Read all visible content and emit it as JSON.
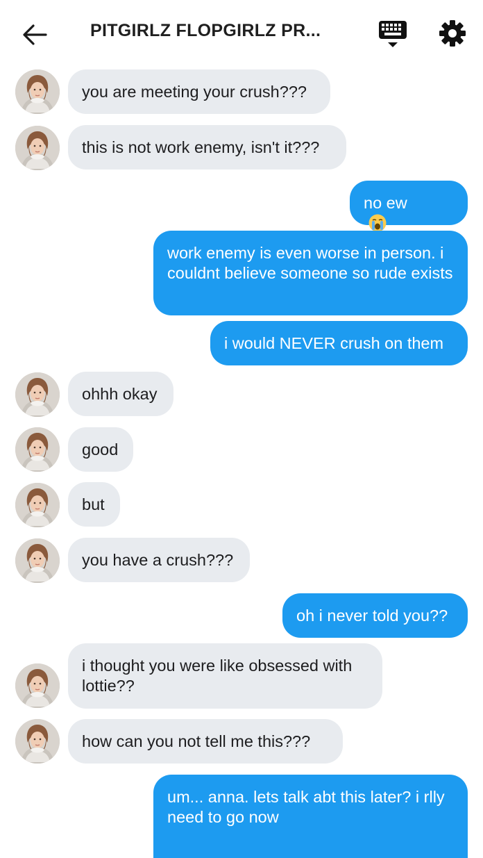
{
  "header": {
    "title": "PITGIRLZ FLOPGIRLZ PR..."
  },
  "messages": [
    {
      "text": "you are meeting your crush???"
    },
    {
      "text": "this is not work enemy, isn't it???"
    },
    {
      "text": "no ew"
    },
    {
      "text": "work enemy is even worse in person. i couldnt believe someone so rude exists"
    },
    {
      "text": "i would NEVER crush on them"
    },
    {
      "text": "ohhh okay"
    },
    {
      "text": "good"
    },
    {
      "text": "but"
    },
    {
      "text": "you have a crush???"
    },
    {
      "text": "oh i never told you??"
    },
    {
      "text": "i thought you were like obsessed with lottie??"
    },
    {
      "text": "how can you not tell me this???"
    },
    {
      "text": "um... anna. lets talk abt this later? i rlly need to go now"
    }
  ],
  "colors": {
    "outgoing_bubble": "#1d9bf0",
    "incoming_bubble": "#e8ebef",
    "text_dark": "#1d1d1f"
  },
  "icons": {
    "back": "arrow-left-icon",
    "keyboard": "keyboard-icon",
    "settings": "gear-icon",
    "emoji": "loudly-crying-face-emoji"
  }
}
